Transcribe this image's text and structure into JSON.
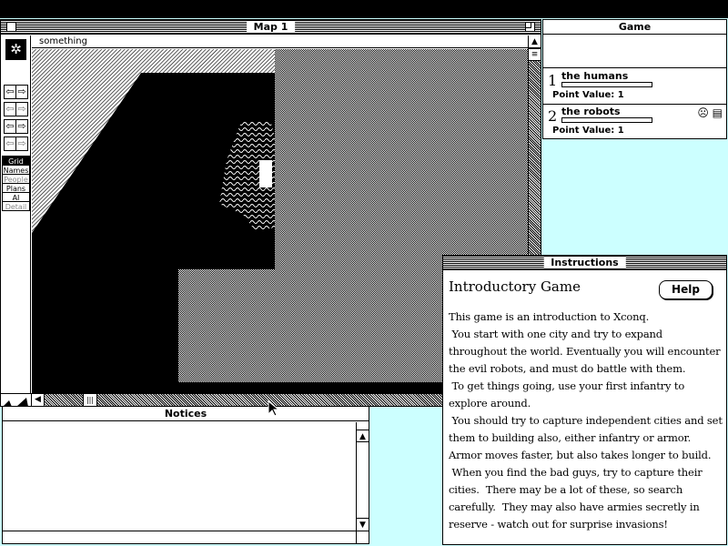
{
  "map_window": {
    "title": "Map 1",
    "status_text": "something",
    "modes": [
      "Grid",
      "Names",
      "People",
      "Plans",
      "AI",
      "Detail"
    ],
    "arrows": [
      "◀",
      "▶",
      "◀",
      "▶",
      "◀",
      "▶",
      "◀",
      "▶"
    ]
  },
  "game_window": {
    "title": "Game",
    "sides": [
      {
        "number": "1",
        "name": "the humans",
        "point_value": "Point Value: 1",
        "progress": 0
      },
      {
        "number": "2",
        "name": "the robots",
        "point_value": "Point Value: 1",
        "progress": 0,
        "icons": "☹ ▤"
      }
    ]
  },
  "instructions_window": {
    "title": "Instructions",
    "heading": "Introductory Game",
    "help_label": "Help",
    "body": "This game is an introduction to Xconq.\n You start with one city and try to expand\nthroughout the world. Eventually you will encounter\nthe evil robots, and must do battle with them.\n To get things going, use your first infantry to\nexplore around.\n You should try to capture independent cities and set\nthem to building also, either infantry or armor.\nArmor moves faster, but also takes longer to build.\n When you find the bad guys, try to capture their\ncities.  There may be a lot of these, so search\ncarefully.  They may also have armies secretly in\nreserve - watch out for surprise invasions!"
  },
  "notices_window": {
    "title": "Notices"
  },
  "colors": {
    "desktop": "#ccffff",
    "menubar": "#000000"
  }
}
